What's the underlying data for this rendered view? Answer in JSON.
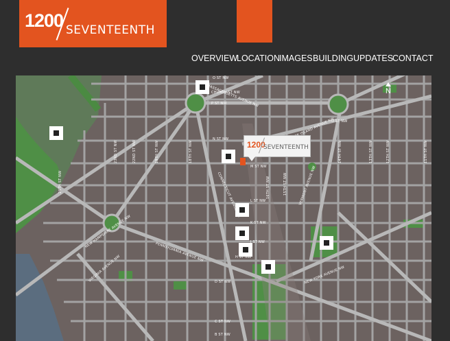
{
  "brand": {
    "number": "1200",
    "word": "SEVENTEENTH"
  },
  "nav": [
    "OVERVIEW",
    "LOCATION",
    "IMAGES",
    "BUILDING",
    "UPDATES",
    "CONTACT"
  ],
  "map": {
    "callout": {
      "number": "1200",
      "word": "SEVENTEENTH"
    },
    "north": "N",
    "streets": {
      "o_st_top": "O ST NW",
      "church_st": "CHURCH ST NW",
      "p_st": "P ST NW",
      "o_st_right": "O ST NW",
      "n_st": "N ST NW",
      "m_st": "M ST NW",
      "l_st": "L ST NW",
      "k_st": "K ST NW",
      "i_st": "I ST NW",
      "h_st": "H ST NW",
      "d_st": "D ST NW",
      "c_st": "C ST NW",
      "b_st": "B ST NW",
      "mass_ave": "MASSACHUSETTS AVENUE NW",
      "rhode_island": "RHODE ISLAND AVENUE NW",
      "connecticut": "CONNECTICUT AVENUE NW",
      "vermont": "VERMONT AVENUE NW",
      "new_hampshire": "NEW HAMPSHIRE AVENUE NW",
      "pennsylvania": "PENNSYLVANIA AVENUE NW",
      "virginia": "VIRGINIA AVENUE NW",
      "new_york": "NEW YORK AVENUE NW",
      "st_26": "26TH ST NW",
      "st_23": "23RD ST NW",
      "st_22": "22ND ST NW",
      "st_19": "19TH ST NW",
      "st_18": "18TH ST NW",
      "st_16": "16TH ST NW",
      "st_15": "15TH ST NW",
      "st_14": "14TH ST NW",
      "st_13": "13TH ST NW",
      "st_12": "12TH ST NW",
      "st_11": "11TH ST NW"
    }
  }
}
